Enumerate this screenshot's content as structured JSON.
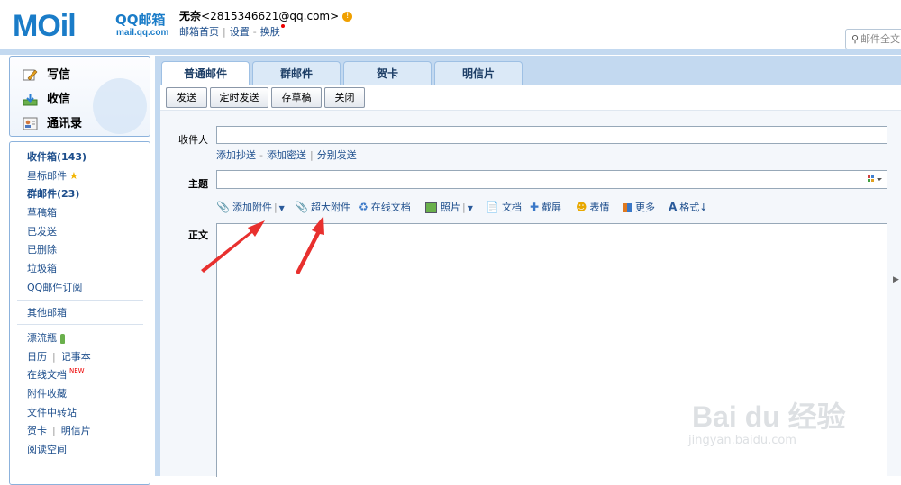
{
  "header": {
    "logo_main": "MOil",
    "logo_qq": "QQ邮箱",
    "logo_domain": "mail.qq.com",
    "user_name": "无奈",
    "user_email": "<2815346621@qq.com>",
    "links": [
      "邮箱首页",
      "设置",
      "换肤"
    ],
    "search_placeholder": "邮件全文"
  },
  "sidebar": {
    "actions": [
      "写信",
      "收信",
      "通讯录"
    ],
    "folders": [
      {
        "label": "收件箱(143)",
        "bold": true
      },
      {
        "label": "星标邮件",
        "bold": false
      },
      {
        "label": "群邮件(23)",
        "bold": true
      },
      {
        "label": "草稿箱",
        "bold": false
      },
      {
        "label": "已发送",
        "bold": false
      },
      {
        "label": "已删除",
        "bold": false
      },
      {
        "label": "垃圾箱",
        "bold": false
      },
      {
        "label": "QQ邮件订阅",
        "bold": false
      }
    ],
    "other_mailbox": "其他邮箱",
    "apps": {
      "drift_bottle": "漂流瓶",
      "calendar": "日历",
      "notepad": "记事本",
      "online_docs": "在线文档",
      "new_tag": "NEW",
      "attachment_collection": "附件收藏",
      "file_transfer": "文件中转站",
      "greeting_card": "贺卡",
      "postcard": "明信片",
      "reading_space": "阅读空间"
    }
  },
  "tabs": [
    "普通邮件",
    "群邮件",
    "贺卡",
    "明信片"
  ],
  "toolbar": {
    "send": "发送",
    "scheduled_send": "定时发送",
    "save_draft": "存草稿",
    "close": "关闭"
  },
  "form": {
    "recipient_label": "收件人",
    "cc_links": [
      "添加抄送",
      "添加密送",
      "分别发送"
    ],
    "subject_label": "主题",
    "body_label": "正文",
    "tools": {
      "add_attachment": "添加附件",
      "large_attachment": "超大附件",
      "online_doc": "在线文档",
      "photo": "照片",
      "document": "文档",
      "screenshot": "截屏",
      "emoticon": "表情",
      "more": "更多",
      "format": "格式"
    }
  },
  "watermark": {
    "brand": "Bai du 经验",
    "url": "jingyan.baidu.com"
  },
  "colors": {
    "brand_blue": "#1a7cc8",
    "link_blue": "#1d4e8c",
    "band_blue": "#c3d9f0",
    "arrow_red": "#e8302e"
  }
}
